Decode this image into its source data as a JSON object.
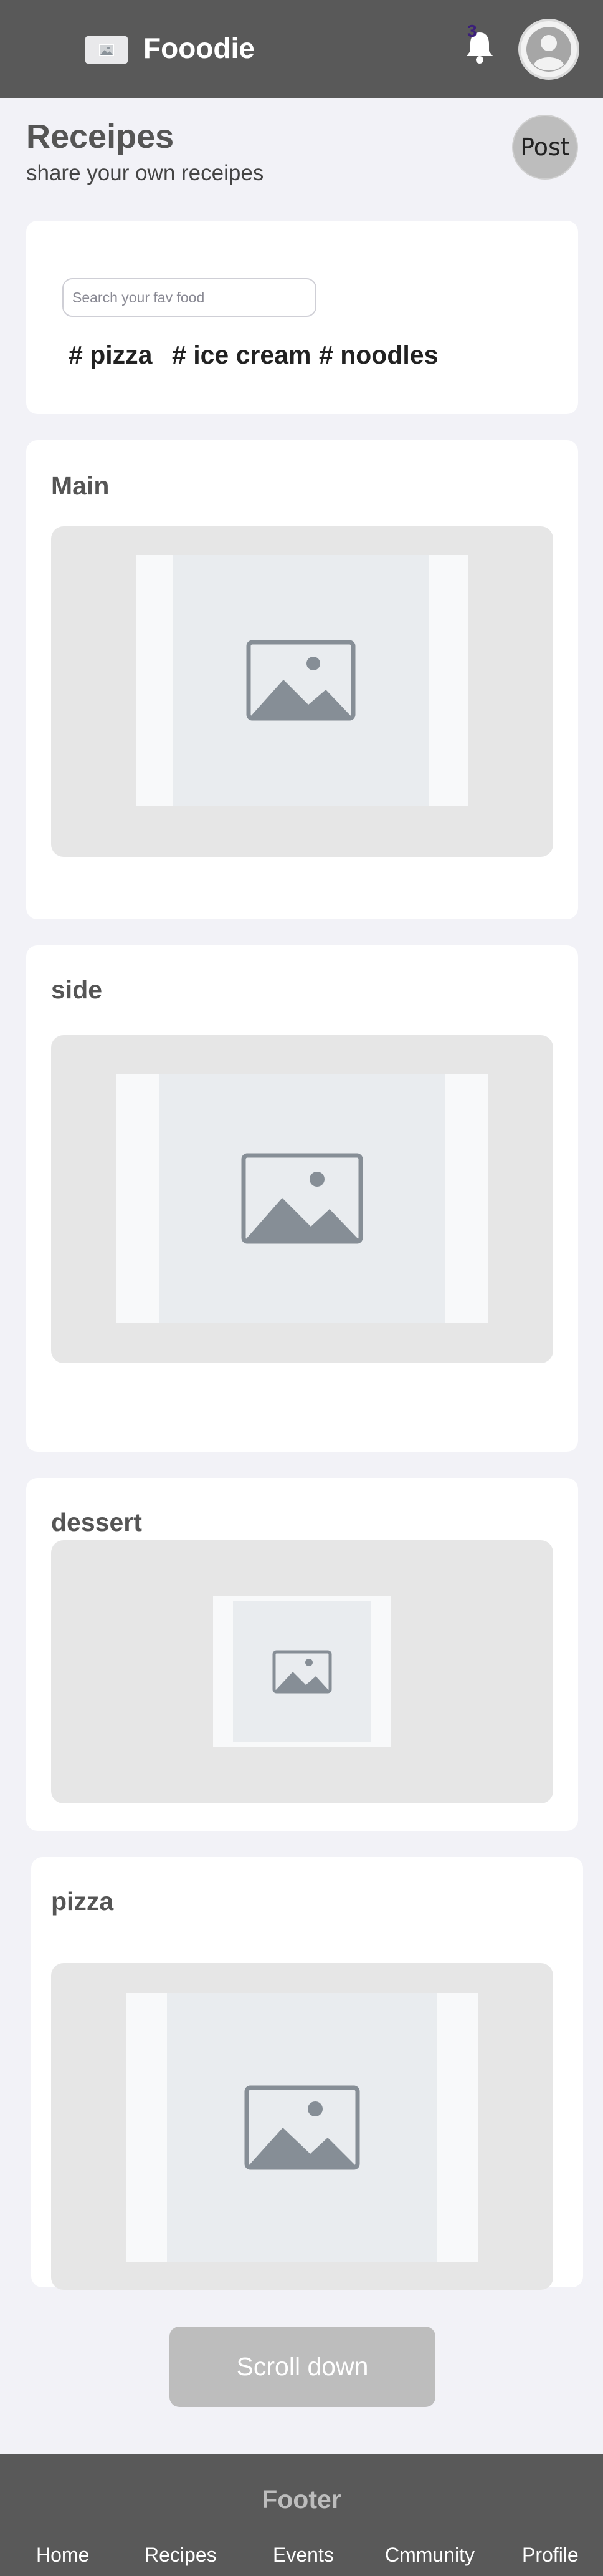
{
  "header": {
    "brand": "Fooodie",
    "notifications_count": "3",
    "logo_icon": "image-placeholder-icon",
    "bell_icon": "bell-icon",
    "avatar_icon": "user-avatar-icon"
  },
  "page": {
    "title": "Receipes",
    "subtitle": "share your own receipes",
    "post_label": "Post"
  },
  "search": {
    "placeholder": "Search your fav food",
    "value": "",
    "tags": [
      "# pizza",
      "# ice cream",
      "# noodles"
    ]
  },
  "sections": [
    {
      "title": "Main",
      "image_icon": "image-placeholder-icon"
    },
    {
      "title": "side",
      "image_icon": "image-placeholder-icon"
    },
    {
      "title": "dessert",
      "image_icon": "image-placeholder-icon"
    },
    {
      "title": "pizza",
      "image_icon": "image-placeholder-icon"
    }
  ],
  "scroll_button": "Scroll down",
  "footer": {
    "title": "Footer",
    "links": [
      "Home",
      "Recipes",
      "Events",
      "Cmmunity",
      "Profile"
    ]
  },
  "colors": {
    "header_bg": "#595959",
    "page_bg": "#f2f2f7",
    "card_bg": "#ffffff",
    "button_bg": "#bdbdbd",
    "badge_text": "#3b1f7a"
  }
}
